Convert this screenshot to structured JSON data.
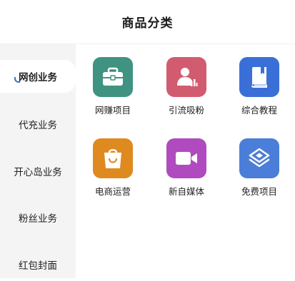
{
  "header": {
    "title": "商品分类"
  },
  "sidebar": {
    "items": [
      {
        "label": "网创业务",
        "active": true
      },
      {
        "label": "代充业务",
        "active": false
      },
      {
        "label": "开心岛业务",
        "active": false
      },
      {
        "label": "粉丝业务",
        "active": false
      },
      {
        "label": "红包封面",
        "active": false
      }
    ]
  },
  "categories": [
    {
      "label": "网赚项目",
      "icon": "briefcase-icon",
      "color": "#3f9380"
    },
    {
      "label": "引流吸粉",
      "icon": "user-chart-icon",
      "color": "#d25c6f"
    },
    {
      "label": "综合教程",
      "icon": "book-icon",
      "color": "#3b6fd8"
    },
    {
      "label": "电商运营",
      "icon": "shopping-bag-icon",
      "color": "#de8a1f"
    },
    {
      "label": "新自媒体",
      "icon": "video-camera-icon",
      "color": "#b04bbf"
    },
    {
      "label": "免费项目",
      "icon": "layers-icon",
      "color": "#4b7ed8"
    }
  ]
}
